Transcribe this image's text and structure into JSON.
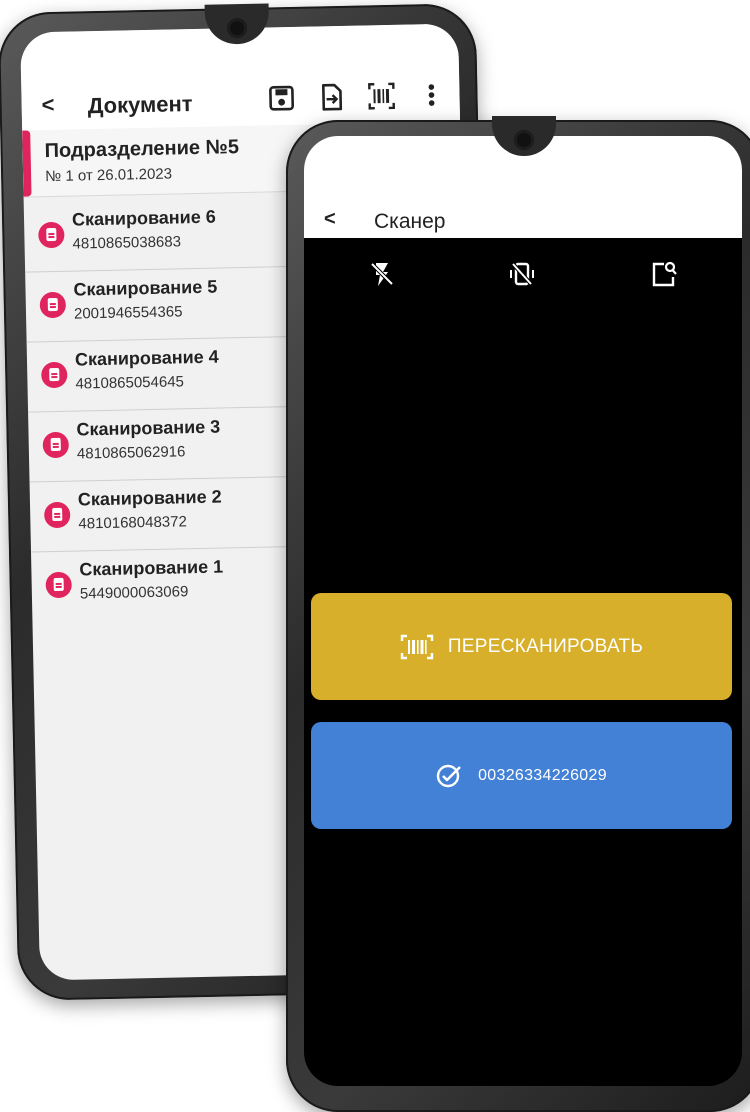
{
  "document_screen": {
    "title": "Документ",
    "back_icon": "chevron-left-icon",
    "toolbar_icons": [
      "save-icon",
      "export-icon",
      "barcode-icon",
      "more-vert-icon"
    ],
    "department": {
      "title": "Подразделение №5",
      "subtitle": "№ 1 от 26.01.2023"
    },
    "scans": [
      {
        "title": "Сканирование 6",
        "code": "4810865038683"
      },
      {
        "title": "Сканирование 5",
        "code": "2001946554365"
      },
      {
        "title": "Сканирование 4",
        "code": "4810865054645"
      },
      {
        "title": "Сканирование 3",
        "code": "4810865062916"
      },
      {
        "title": "Сканирование 2",
        "code": "4810168048372"
      },
      {
        "title": "Сканирование 1",
        "code": "5449000063069"
      }
    ],
    "accent_color": "#e0245e"
  },
  "scanner_screen": {
    "title": "Сканер",
    "back_icon": "chevron-left-icon",
    "toolbar_icons": [
      "flash-off-icon",
      "vibration-off-icon",
      "image-search-icon"
    ],
    "rescan_label": "ПЕРЕСКАНИРОВАТЬ",
    "result_code": "00326334226029",
    "rescan_color": "#d7af2b",
    "result_color": "#4281d6"
  }
}
